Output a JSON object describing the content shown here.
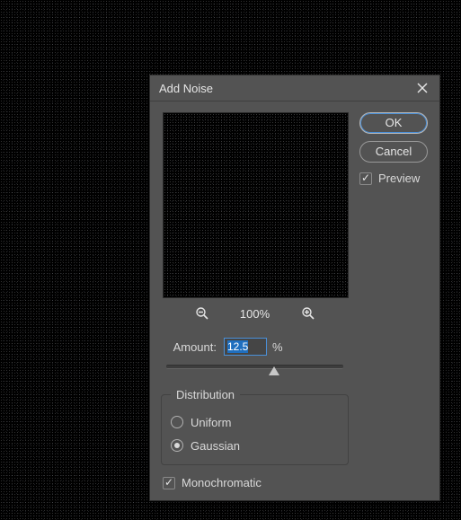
{
  "dialog": {
    "title": "Add Noise",
    "buttons": {
      "ok": "OK",
      "cancel": "Cancel"
    },
    "preview_checkbox": "Preview",
    "preview_checked": true,
    "zoom_label": "100%",
    "amount": {
      "label": "Amount:",
      "value": "12.5",
      "suffix": "%",
      "slider_min": 0.1,
      "slider_max": 400,
      "slider_value": 12.5
    },
    "distribution": {
      "legend": "Distribution",
      "options": {
        "uniform": "Uniform",
        "gaussian": "Gaussian"
      },
      "selected": "gaussian"
    },
    "monochromatic": {
      "label": "Monochromatic",
      "checked": true
    }
  },
  "icons": {
    "close": "close-icon",
    "zoom_out": "zoom-out-icon",
    "zoom_in": "zoom-in-icon"
  }
}
